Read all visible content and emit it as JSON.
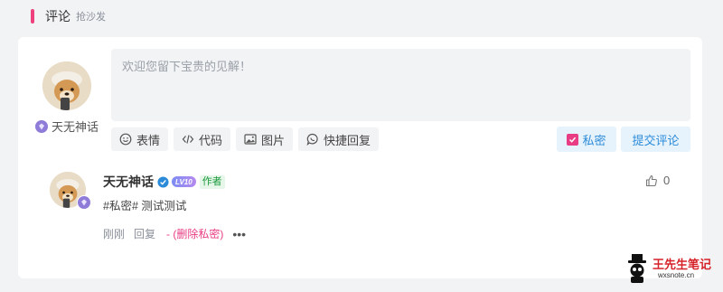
{
  "section": {
    "title": "评论",
    "subtitle": "抢沙发"
  },
  "composer": {
    "user_name": "天无神话",
    "placeholder": "欢迎您留下宝贵的见解！",
    "tools": [
      {
        "icon": "smile-icon",
        "label": "表情"
      },
      {
        "icon": "code-icon",
        "label": "代码"
      },
      {
        "icon": "image-icon",
        "label": "图片"
      },
      {
        "icon": "reply-bubble-icon",
        "label": "快捷回复"
      }
    ],
    "private_label": "私密",
    "private_checked": true,
    "submit_label": "提交评论"
  },
  "comment": {
    "author": "天无神话",
    "level": "LV10",
    "author_tag": "作者",
    "text": "#私密# 测试测试",
    "time": "刚刚",
    "reply_label": "回复",
    "delete_private": "- (删除私密)",
    "more": "•••",
    "likes": "0"
  },
  "watermark": {
    "title": "王先生笔记",
    "url": "wxsnote.cn"
  },
  "colors": {
    "accent": "#f0417f",
    "primary": "#2c8bd8",
    "pink": "#e83d84",
    "author_green": "#1a9a3a"
  }
}
